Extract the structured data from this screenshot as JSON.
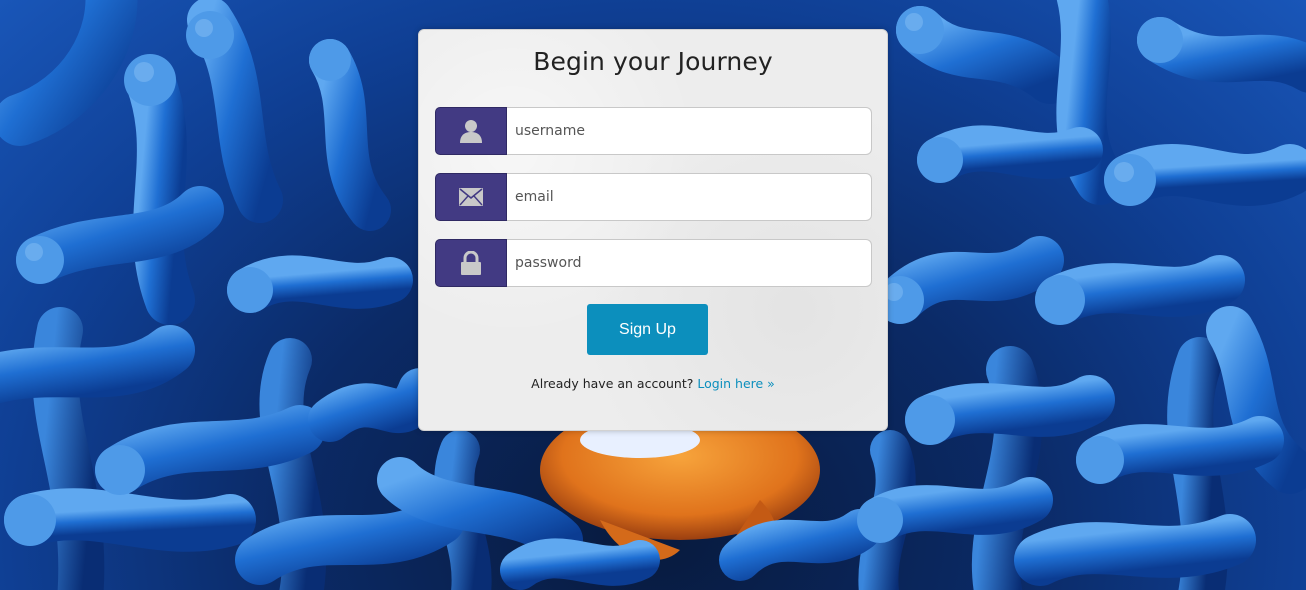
{
  "form": {
    "title": "Begin your Journey",
    "username": {
      "placeholder": "username",
      "value": "",
      "icon": "user-icon"
    },
    "email": {
      "placeholder": "email",
      "value": "",
      "icon": "envelope-icon"
    },
    "password": {
      "placeholder": "password",
      "value": "",
      "icon": "lock-icon"
    },
    "submit_label": "Sign Up",
    "account_prompt": "Already have an account?",
    "login_link": "Login here »"
  },
  "colors": {
    "icon_box": "#423a83",
    "button": "#0c8fbd",
    "link": "#0c8fbd",
    "card": "#ededed",
    "background": "#0f3f94"
  }
}
